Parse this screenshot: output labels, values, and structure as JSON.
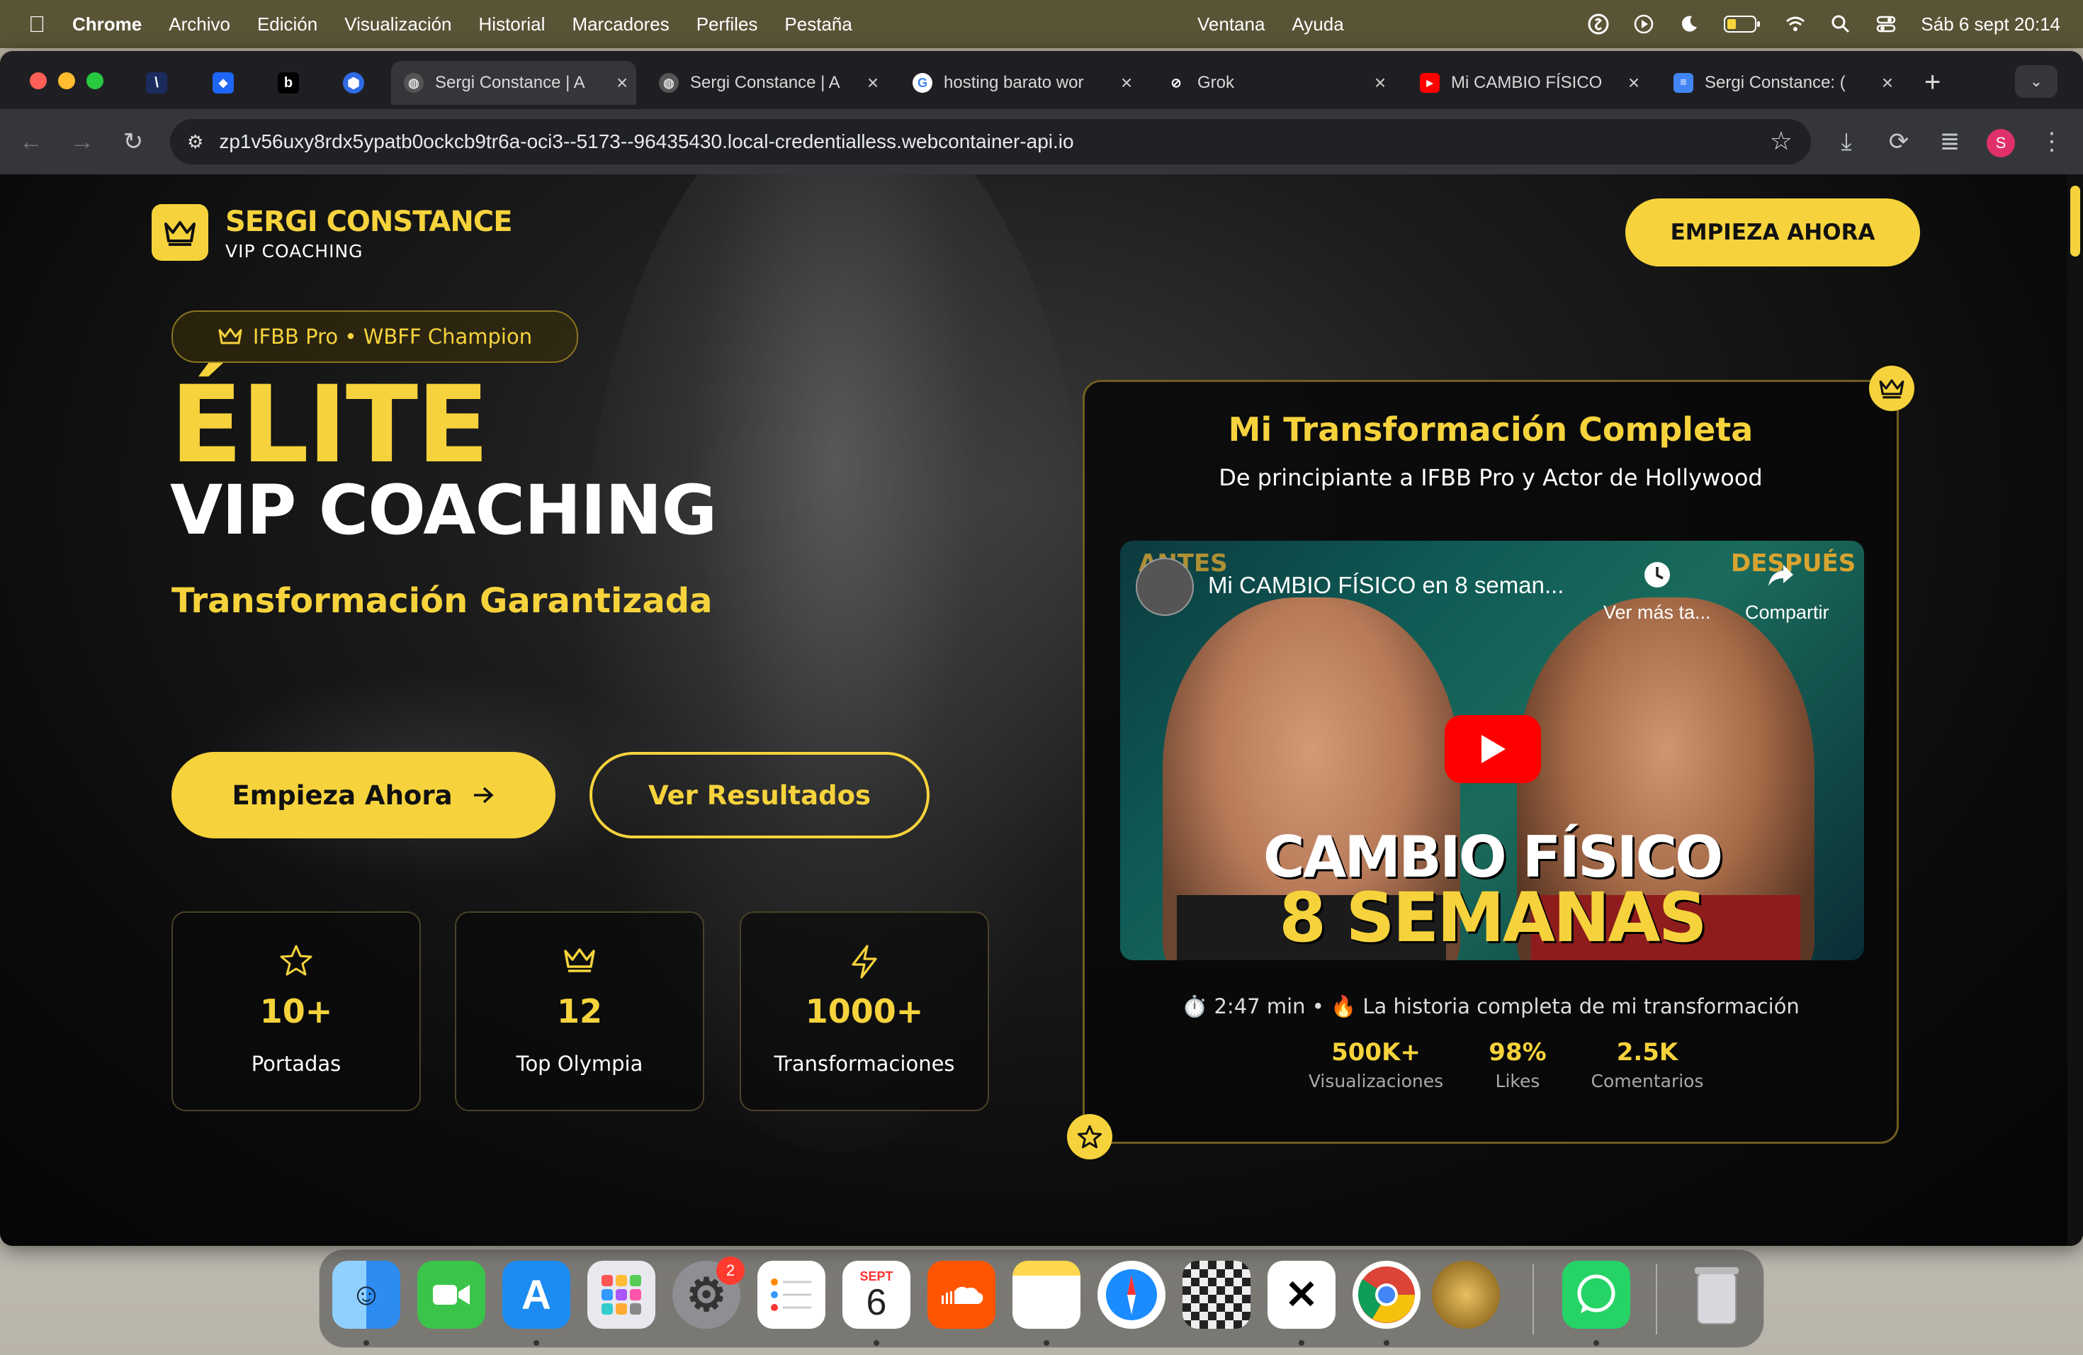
{
  "menubar": {
    "app": "Chrome",
    "items": [
      "Archivo",
      "Edición",
      "Visualización",
      "Historial",
      "Marcadores",
      "Perfiles",
      "Pestaña"
    ],
    "center_items": [
      "Ventana",
      "Ayuda"
    ],
    "datetime": "Sáb 6 sept 20:14"
  },
  "browser": {
    "tabs": [
      {
        "title": "Sergi Constance | A",
        "active": true
      },
      {
        "title": "Sergi Constance | A"
      },
      {
        "title": "hosting barato wor"
      },
      {
        "title": "Grok"
      },
      {
        "title": "Mi CAMBIO FÍSICO"
      },
      {
        "title": "Sergi Constance: ("
      }
    ],
    "url": "zp1v56uxy8rdx5ypatb0ockcb9tr6a-oci3--5173--96435430.local-credentialless.webcontainer-api.io",
    "profile_initial": "S"
  },
  "site": {
    "brand_name": "SERGI CONSTANCE",
    "brand_sub": "VIP COACHING",
    "cta_top": "EMPIEZA AHORA",
    "badge": "IFBB Pro • WBFF Champion",
    "headline_1": "ÉLITE",
    "headline_2": "VIP COACHING",
    "tagline": "Transformación Garantizada",
    "btn_start": "Empieza Ahora",
    "btn_results": "Ver Resultados",
    "stats": [
      {
        "value": "10+",
        "label": "Portadas",
        "icon": "star-icon"
      },
      {
        "value": "12",
        "label": "Top Olympia",
        "icon": "crown-icon"
      },
      {
        "value": "1000+",
        "label": "Transformaciones",
        "icon": "lightning-icon"
      }
    ],
    "card": {
      "title": "Mi Transformación Completa",
      "subtitle": "De principiante a IFBB Pro y Actor de Hollywood",
      "video": {
        "title": "Mi CAMBIO FÍSICO en 8 seman...",
        "label_before": "ANTES",
        "label_after": "DESPUÉS",
        "watch_later": "Ver más ta...",
        "share": "Compartir",
        "overlay_line1": "CAMBIO FÍSICO",
        "overlay_line2": "8 SEMANAS"
      },
      "meta": "⏱️ 2:47 min • 🔥 La historia completa de mi transformación",
      "stats": [
        {
          "value": "500K+",
          "label": "Visualizaciones"
        },
        {
          "value": "98%",
          "label": "Likes"
        },
        {
          "value": "2.5K",
          "label": "Comentarios"
        }
      ]
    }
  },
  "dock": {
    "settings_badge": "2",
    "calendar_month": "SEPT",
    "calendar_day": "6"
  },
  "colors": {
    "accent": "#f6d33c",
    "background": "#0a0a0a",
    "youtube_red": "#ff0000"
  }
}
